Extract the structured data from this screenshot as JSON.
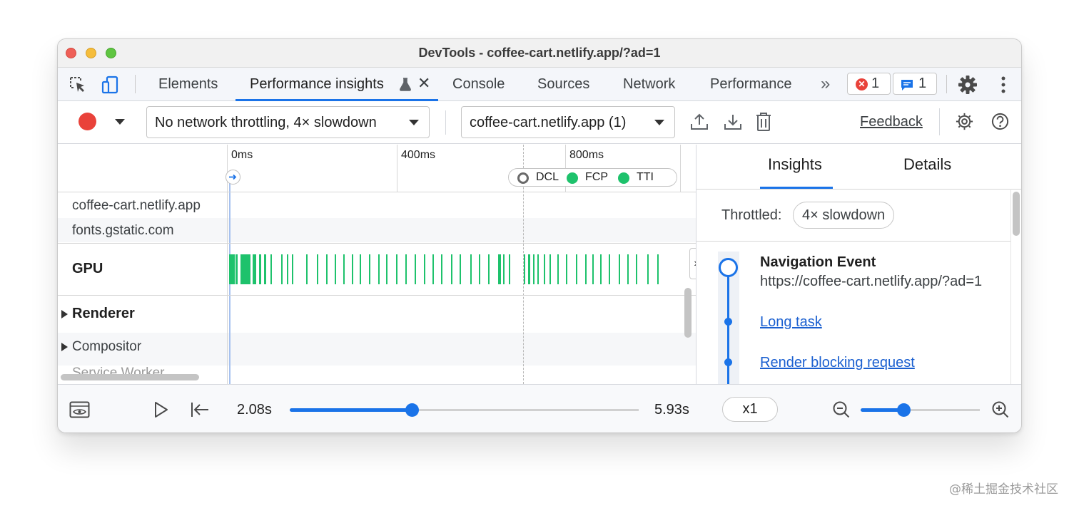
{
  "window": {
    "title": "DevTools - coffee-cart.netlify.app/?ad=1"
  },
  "tabs": [
    {
      "label": "Elements"
    },
    {
      "label": "Performance insights"
    },
    {
      "label": "Console"
    },
    {
      "label": "Sources"
    },
    {
      "label": "Network"
    },
    {
      "label": "Performance"
    }
  ],
  "badges": {
    "errors": "1",
    "messages": "1"
  },
  "toolbar": {
    "throttling": "No network throttling, 4× slowdown",
    "page": "coffee-cart.netlify.app (1)",
    "feedback": "Feedback"
  },
  "timeline": {
    "ticks": [
      "0ms",
      "400ms",
      "800ms"
    ],
    "markers": [
      "DCL",
      "FCP",
      "TTI"
    ],
    "network_tracks": [
      "coffee-cart.netlify.app",
      "fonts.gstatic.com"
    ],
    "tracks": [
      "GPU",
      "Renderer",
      "Compositor"
    ]
  },
  "insights": {
    "tabs": [
      "Insights",
      "Details"
    ],
    "throttled_label": "Throttled:",
    "throttled_value": "4× slowdown",
    "event_title": "Navigation Event",
    "event_url": "https://coffee-cart.netlify.app/?ad=1",
    "links": [
      "Long task",
      "Render blocking request"
    ]
  },
  "playback": {
    "start": "2.08s",
    "end": "5.93s",
    "speed": "x1",
    "progress": 0.35,
    "zoom": 0.36
  },
  "colors": {
    "accent": "#1a73e8",
    "gpu": "#1ec26c",
    "record": "#e9423a"
  },
  "watermark": "@稀土掘金技术社区"
}
